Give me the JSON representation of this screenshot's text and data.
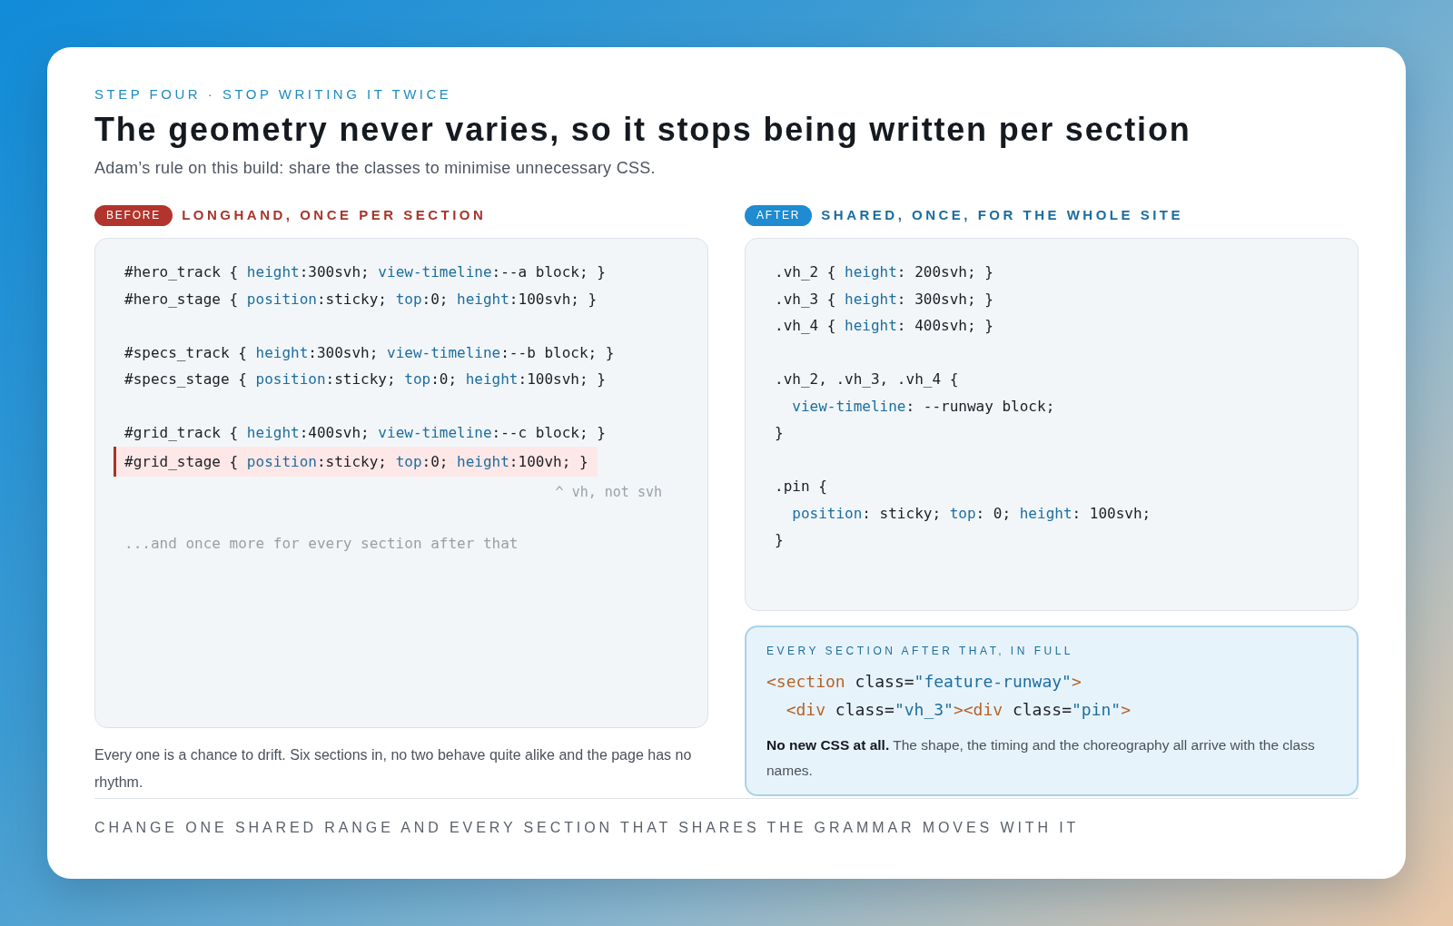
{
  "header": {
    "eyebrow": "STEP FOUR · STOP WRITING IT TWICE",
    "title": "The geometry never varies, so it stops being written per section",
    "subtitle": "Adam’s rule on this build: share the classes to minimise unnecessary CSS."
  },
  "panels": [
    {
      "kind": "before",
      "badge": "BEFORE",
      "heading": "LONGHAND, ONCE PER SECTION",
      "code_blocks": [
        {
          "lines": [
            {
              "highlighted": false,
              "tokens": [
                {
                  "kind": "plain",
                  "text": "#hero_track { "
                },
                {
                  "kind": "property",
                  "text": "height"
                },
                {
                  "kind": "plain",
                  "text": ":300svh; "
                },
                {
                  "kind": "property",
                  "text": "view-timeline"
                },
                {
                  "kind": "plain",
                  "text": ":--a block; }"
                }
              ]
            },
            {
              "highlighted": false,
              "tokens": [
                {
                  "kind": "plain",
                  "text": "#hero_stage { "
                },
                {
                  "kind": "property",
                  "text": "position"
                },
                {
                  "kind": "plain",
                  "text": ":sticky; "
                },
                {
                  "kind": "property",
                  "text": "top"
                },
                {
                  "kind": "plain",
                  "text": ":0; "
                },
                {
                  "kind": "property",
                  "text": "height"
                },
                {
                  "kind": "plain",
                  "text": ":100svh; }"
                }
              ]
            }
          ]
        },
        {
          "lines": [
            {
              "highlighted": false,
              "tokens": [
                {
                  "kind": "plain",
                  "text": "#specs_track { "
                },
                {
                  "kind": "property",
                  "text": "height"
                },
                {
                  "kind": "plain",
                  "text": ":300svh; "
                },
                {
                  "kind": "property",
                  "text": "view-timeline"
                },
                {
                  "kind": "plain",
                  "text": ":--b block; }"
                }
              ]
            },
            {
              "highlighted": false,
              "tokens": [
                {
                  "kind": "plain",
                  "text": "#specs_stage { "
                },
                {
                  "kind": "property",
                  "text": "position"
                },
                {
                  "kind": "plain",
                  "text": ":sticky; "
                },
                {
                  "kind": "property",
                  "text": "top"
                },
                {
                  "kind": "plain",
                  "text": ":0; "
                },
                {
                  "kind": "property",
                  "text": "height"
                },
                {
                  "kind": "plain",
                  "text": ":100svh; }"
                }
              ]
            }
          ]
        },
        {
          "lines": [
            {
              "highlighted": false,
              "tokens": [
                {
                  "kind": "plain",
                  "text": "#grid_track { "
                },
                {
                  "kind": "property",
                  "text": "height"
                },
                {
                  "kind": "plain",
                  "text": ":400svh; "
                },
                {
                  "kind": "property",
                  "text": "view-timeline"
                },
                {
                  "kind": "plain",
                  "text": ":--c block; }"
                }
              ]
            },
            {
              "highlighted": true,
              "tokens": [
                {
                  "kind": "plain",
                  "text": "#grid_stage { "
                },
                {
                  "kind": "property",
                  "text": "position"
                },
                {
                  "kind": "plain",
                  "text": ":sticky; "
                },
                {
                  "kind": "property",
                  "text": "top"
                },
                {
                  "kind": "plain",
                  "text": ":0; "
                },
                {
                  "kind": "property",
                  "text": "height"
                },
                {
                  "kind": "plain",
                  "text": ":100vh; }"
                }
              ]
            }
          ]
        }
      ],
      "note": "^ vh, not svh",
      "trailer": "...and once more for every section after that",
      "caption": "Every one is a chance to drift. Six sections in, no two behave quite alike and the page has no rhythm."
    },
    {
      "kind": "after",
      "badge": "AFTER",
      "heading": "SHARED, ONCE, FOR THE WHOLE SITE",
      "code_blocks": [
        {
          "lines": [
            {
              "highlighted": false,
              "tokens": [
                {
                  "kind": "plain",
                  "text": ".vh_2 { "
                },
                {
                  "kind": "property",
                  "text": "height"
                },
                {
                  "kind": "plain",
                  "text": ": 200svh; }"
                }
              ]
            },
            {
              "highlighted": false,
              "tokens": [
                {
                  "kind": "plain",
                  "text": ".vh_3 { "
                },
                {
                  "kind": "property",
                  "text": "height"
                },
                {
                  "kind": "plain",
                  "text": ": 300svh; }"
                }
              ]
            },
            {
              "highlighted": false,
              "tokens": [
                {
                  "kind": "plain",
                  "text": ".vh_4 { "
                },
                {
                  "kind": "property",
                  "text": "height"
                },
                {
                  "kind": "plain",
                  "text": ": 400svh; }"
                }
              ]
            }
          ]
        },
        {
          "lines": [
            {
              "highlighted": false,
              "tokens": [
                {
                  "kind": "plain",
                  "text": ".vh_2, .vh_3, .vh_4 {"
                }
              ]
            },
            {
              "highlighted": false,
              "tokens": [
                {
                  "kind": "property",
                  "text": "  view-timeline"
                },
                {
                  "kind": "plain",
                  "text": ": --runway block;"
                }
              ]
            },
            {
              "highlighted": false,
              "tokens": [
                {
                  "kind": "plain",
                  "text": "}"
                }
              ]
            }
          ]
        },
        {
          "lines": [
            {
              "highlighted": false,
              "tokens": [
                {
                  "kind": "plain",
                  "text": ".pin {"
                }
              ]
            },
            {
              "highlighted": false,
              "tokens": [
                {
                  "kind": "property",
                  "text": "  position"
                },
                {
                  "kind": "plain",
                  "text": ": sticky; "
                },
                {
                  "kind": "property",
                  "text": "top"
                },
                {
                  "kind": "plain",
                  "text": ": 0; "
                },
                {
                  "kind": "property",
                  "text": "height"
                },
                {
                  "kind": "plain",
                  "text": ": 100svh;"
                }
              ]
            },
            {
              "highlighted": false,
              "tokens": [
                {
                  "kind": "plain",
                  "text": "}"
                }
              ]
            }
          ]
        }
      ],
      "callout": {
        "label": "EVERY SECTION AFTER THAT, IN FULL",
        "lines": [
          {
            "tokens": [
              {
                "kind": "tag",
                "text": "<section"
              },
              {
                "kind": "plain",
                "text": " class="
              },
              {
                "kind": "string",
                "text": "\"feature-runway\""
              },
              {
                "kind": "tag",
                "text": ">"
              }
            ]
          },
          {
            "tokens": [
              {
                "kind": "tag",
                "text": "  <div"
              },
              {
                "kind": "plain",
                "text": " class="
              },
              {
                "kind": "string",
                "text": "\"vh_3\""
              },
              {
                "kind": "tag",
                "text": "><div"
              },
              {
                "kind": "plain",
                "text": " class="
              },
              {
                "kind": "string",
                "text": "\"pin\""
              },
              {
                "kind": "tag",
                "text": ">"
              }
            ]
          }
        ],
        "text": "**No new CSS at all.** The shape, the timing and the choreography all arrive with the class names."
      }
    }
  ],
  "footer": "CHANGE ONE SHARED RANGE AND EVERY SECTION THAT SHARES THE GRAMMAR MOVES WITH IT"
}
